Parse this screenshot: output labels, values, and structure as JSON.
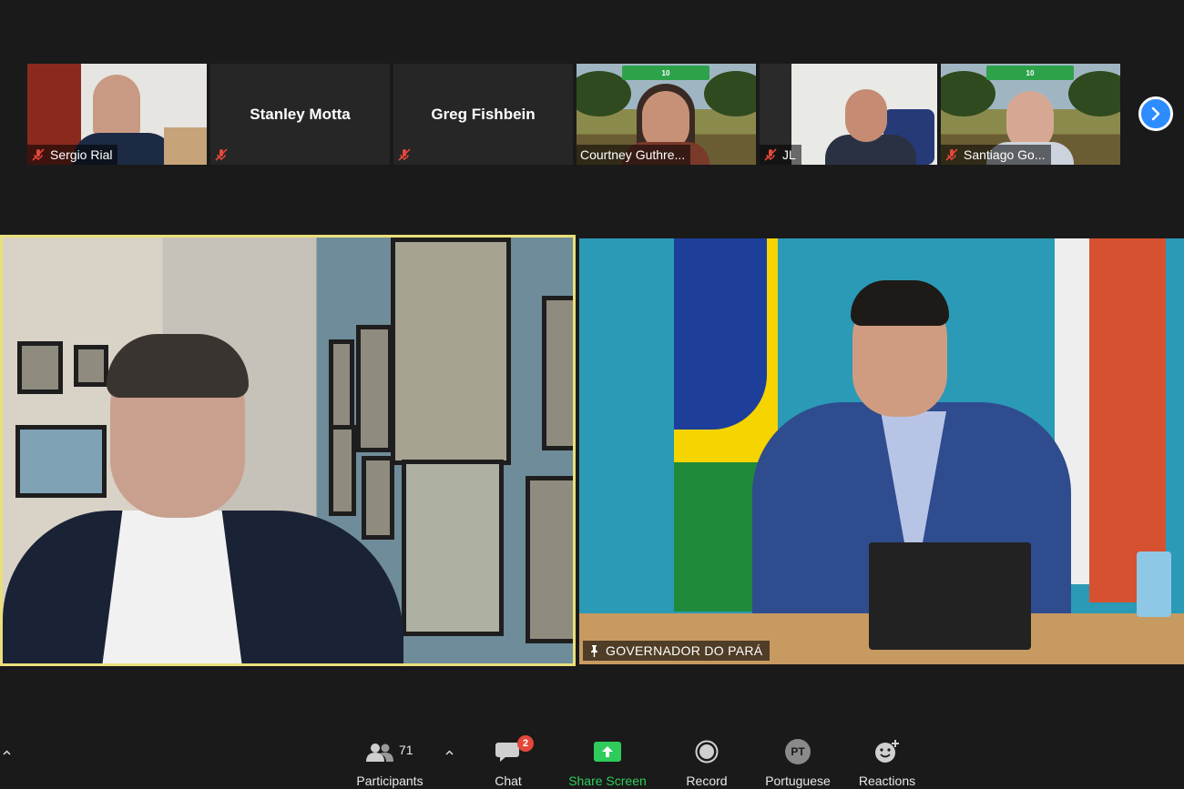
{
  "gallery": {
    "participants": [
      {
        "name": "Sergio Rial",
        "has_video": true
      },
      {
        "name": "Stanley Motta",
        "has_video": false
      },
      {
        "name": "Greg Fishbein",
        "has_video": false
      },
      {
        "name": "Courtney Guthre...",
        "has_video": true
      },
      {
        "name": "JL",
        "has_video": true
      },
      {
        "name": "Santiago Go...",
        "has_video": true
      }
    ],
    "banner_text": "10"
  },
  "main": {
    "left_video": {
      "speaker_active": true
    },
    "right_video": {
      "label": "GOVERNADOR DO PARÁ"
    }
  },
  "toolbar": {
    "participants_label": "Participants",
    "participants_count": "71",
    "chat_label": "Chat",
    "chat_badge": "2",
    "share_label": "Share Screen",
    "record_label": "Record",
    "language_label": "Portuguese",
    "language_code": "PT",
    "reactions_label": "Reactions"
  },
  "colors": {
    "accent": "#2d8cff",
    "share_green": "#2fcc5c",
    "active_speaker": "#e9e07a",
    "badge_red": "#e3483a"
  }
}
